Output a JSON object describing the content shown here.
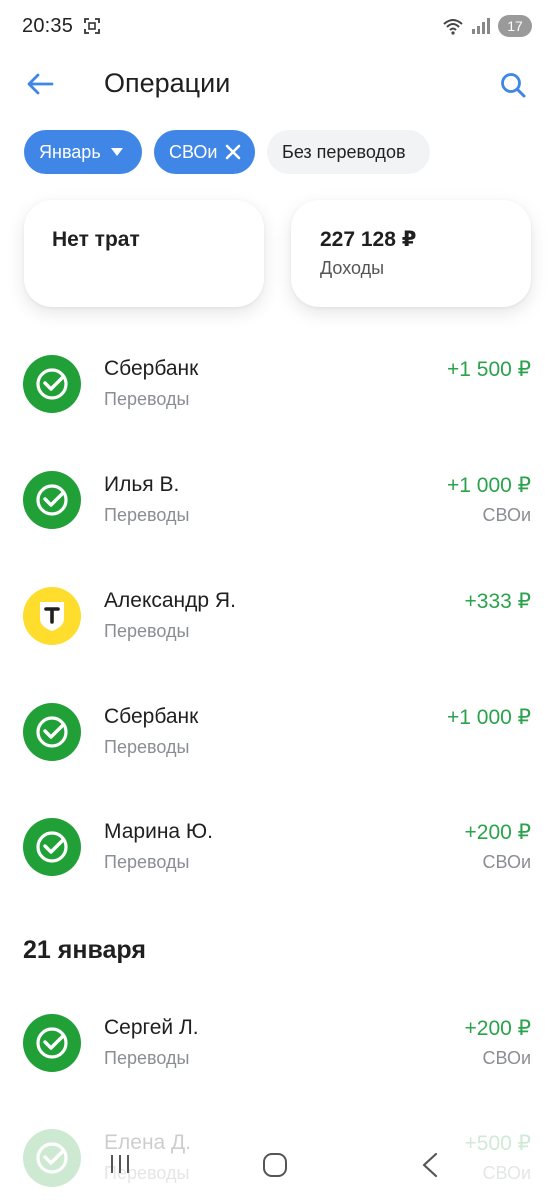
{
  "status_bar": {
    "time": "20:35",
    "battery": "17",
    "icons": [
      "screenshot-icon",
      "wifi-icon",
      "signal-icon"
    ]
  },
  "header": {
    "title": "Операции",
    "back_icon": "arrow-left-icon",
    "search_icon": "search-icon"
  },
  "filters": {
    "month_label": "Январь",
    "tag_label": "СВОи",
    "transfers_label": "Без переводов"
  },
  "summary": {
    "spend_label": "Нет трат",
    "income_amount": "227 128 ₽",
    "income_label": "Доходы"
  },
  "operations": [
    {
      "name": "Сбербанк",
      "category": "Переводы",
      "amount": "+1 500 ₽",
      "tag": "",
      "bank": "sber"
    },
    {
      "name": "Илья В.",
      "category": "Переводы",
      "amount": "+1 000 ₽",
      "tag": "СВОи",
      "bank": "sber"
    },
    {
      "name": "Александр Я.",
      "category": "Переводы",
      "amount": "+333 ₽",
      "tag": "",
      "bank": "tbank"
    },
    {
      "name": "Сбербанк",
      "category": "Переводы",
      "amount": "+1 000 ₽",
      "tag": "",
      "bank": "sber"
    },
    {
      "name": "Марина Ю.",
      "category": "Переводы",
      "amount": "+200 ₽",
      "tag": "СВОи",
      "bank": "sber"
    }
  ],
  "date_group": "21 января",
  "operations_after": [
    {
      "name": "Сергей Л.",
      "category": "Переводы",
      "amount": "+200 ₽",
      "tag": "СВОи",
      "bank": "sber"
    },
    {
      "name": "Елена Д.",
      "category": "Переводы",
      "amount": "+500 ₽",
      "tag": "СВОи",
      "bank": "sber"
    }
  ],
  "colors": {
    "accent": "#3f86e6",
    "income_green": "#2ba24c",
    "sber_green": "#21a038",
    "tbank_yellow": "#ffdd2d"
  },
  "nav_icons": [
    "recents-icon",
    "home-icon",
    "back-icon"
  ]
}
